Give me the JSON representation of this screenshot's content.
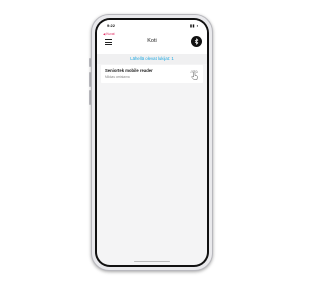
{
  "status_bar": {
    "time": "9:22",
    "icons": "▮▮ ◗"
  },
  "header": {
    "back_label": "◀ Kuvat",
    "title": "Koti",
    "menu_icon": "hamburger-menu-icon",
    "bluetooth_icon": "bluetooth-icon"
  },
  "nearby": {
    "label": "Lähellä olevat lukijat: 1"
  },
  "locks": [
    {
      "name": "Seniortek mobile reader",
      "status": "Mikkas omistama",
      "icon": "touch-tap-icon"
    }
  ],
  "colors": {
    "accent_blue": "#1ba6e0",
    "back_pink": "#e0245e",
    "screen_bg": "#f4f4f5"
  }
}
